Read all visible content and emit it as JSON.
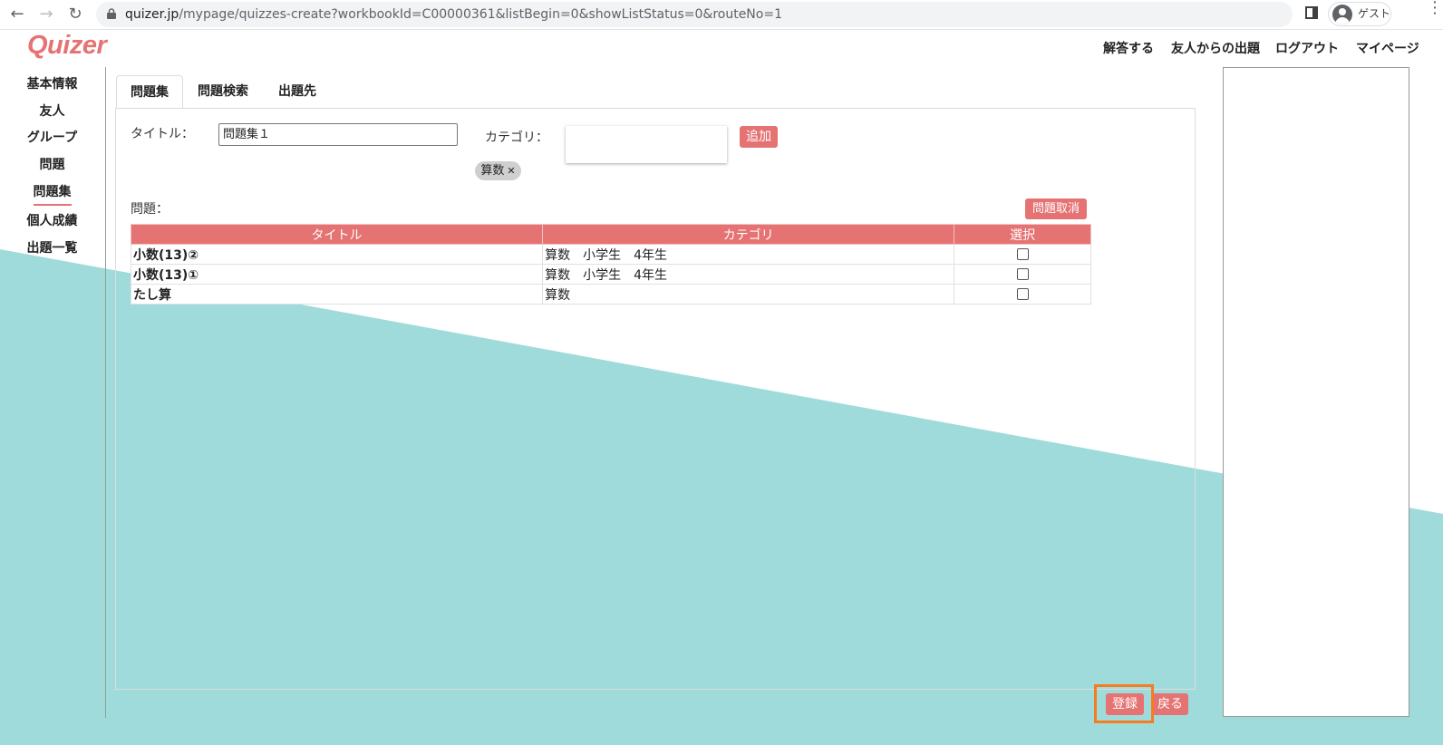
{
  "browser": {
    "url_host": "quizer.jp",
    "url_path": "/mypage/quizzes-create?workbookId=C00000361&listBegin=0&showListStatus=0&routeNo=1",
    "profile_label": "ゲスト"
  },
  "site": {
    "logo": "Quizer",
    "topnav": [
      "解答する",
      "友人からの出題",
      "ログアウト",
      "マイページ"
    ]
  },
  "sidenav": {
    "items": [
      "基本情報",
      "友人",
      "グループ",
      "問題",
      "問題集",
      "個人成績",
      "出題一覧"
    ],
    "active": "問題集"
  },
  "tabs": [
    "問題集",
    "問題検索",
    "出題先"
  ],
  "active_tab": "問題集",
  "form": {
    "title_label": "タイトル：",
    "title_value": "問題集１",
    "category_label": "カテゴリ：",
    "add_button": "追加",
    "category_chip": "算数",
    "questions_label": "問題：",
    "cancel_questions_button": "問題取消"
  },
  "table": {
    "headers": [
      "タイトル",
      "カテゴリ",
      "選択"
    ],
    "rows": [
      {
        "title": "小数(13)②",
        "category": "算数　小学生　4年生",
        "selected": false
      },
      {
        "title": "小数(13)①",
        "category": "算数　小学生　4年生",
        "selected": false
      },
      {
        "title": "たし算",
        "category": "算数",
        "selected": false
      }
    ]
  },
  "actions": {
    "register_button": "登録",
    "back_button": "戻る"
  },
  "colors": {
    "accent": "#e57373",
    "teal_background": "#a0dbdb",
    "highlight": "#f57c1f"
  }
}
